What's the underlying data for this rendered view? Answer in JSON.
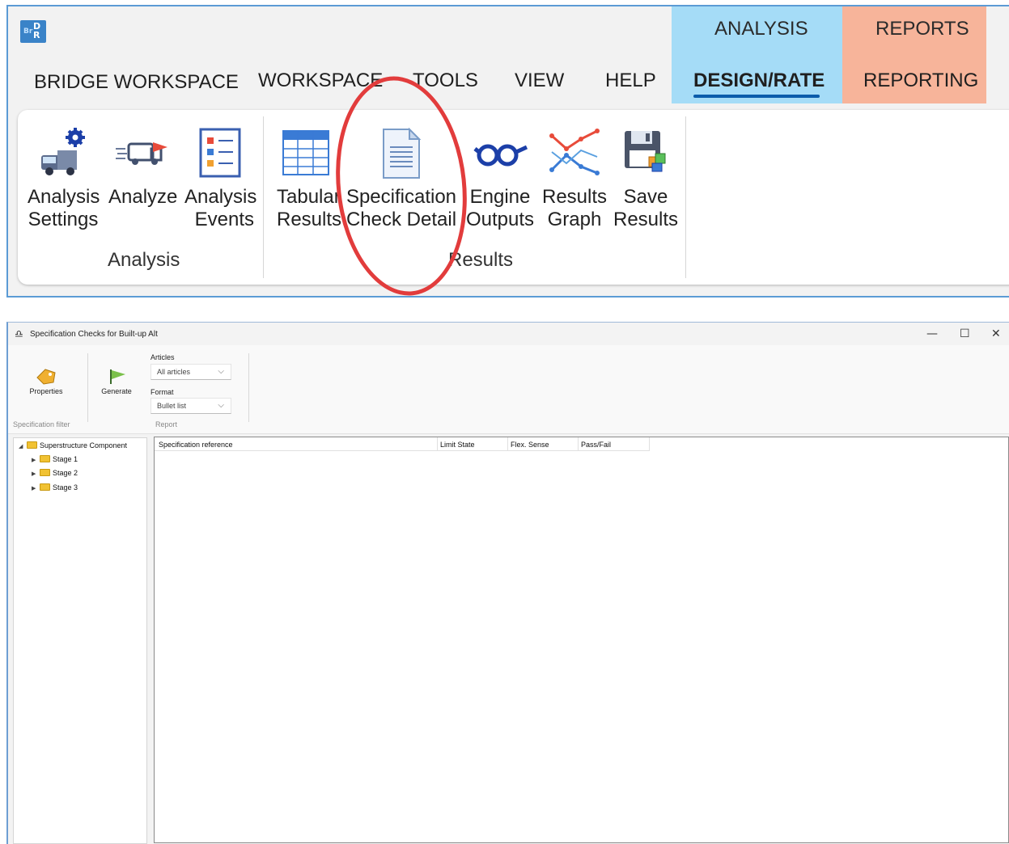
{
  "ribbon": {
    "app_logo": "BrDR",
    "context_groups": [
      "ANALYSIS",
      "REPORTS"
    ],
    "tabs": [
      "BRIDGE WORKSPACE",
      "WORKSPACE",
      "TOOLS",
      "VIEW",
      "HELP",
      "DESIGN/RATE",
      "REPORTING"
    ],
    "active_tab": "DESIGN/RATE",
    "buttons": [
      {
        "line1": "Analysis",
        "line2": "Settings",
        "icon": "truck-gear-icon"
      },
      {
        "line1": "Analyze",
        "line2": "",
        "icon": "truck-speed-icon"
      },
      {
        "line1": "Analysis",
        "line2": "Events",
        "icon": "checklist-icon"
      },
      {
        "line1": "Tabular",
        "line2": "Results",
        "icon": "table-icon"
      },
      {
        "line1": "Specification",
        "line2": "Check Detail",
        "icon": "document-icon"
      },
      {
        "line1": "Engine",
        "line2": "Outputs",
        "icon": "glasses-icon"
      },
      {
        "line1": "Results",
        "line2": "Graph",
        "icon": "line-graph-icon"
      },
      {
        "line1": "Save",
        "line2": "Results",
        "icon": "floppy-disk-icon"
      }
    ],
    "groups": [
      "Analysis",
      "Results"
    ],
    "highlight_color": "#e23c3c"
  },
  "dialog": {
    "title": "Specification Checks for Built-up Alt",
    "window_buttons": [
      "—",
      "☐",
      "✕"
    ],
    "toolbar": {
      "properties_label": "Properties",
      "generate_label": "Generate",
      "articles_label": "Articles",
      "articles_value": "All articles",
      "format_label": "Format",
      "format_value": "Bullet list",
      "group_filter": "Specification filter",
      "group_report": "Report"
    },
    "tree": {
      "root": "Superstructure Component",
      "children": [
        "Stage 1",
        "Stage 2",
        "Stage 3"
      ]
    },
    "grid": {
      "columns": [
        "Specification reference",
        "Limit State",
        "Flex. Sense",
        "Pass/Fail"
      ],
      "rows": []
    }
  }
}
